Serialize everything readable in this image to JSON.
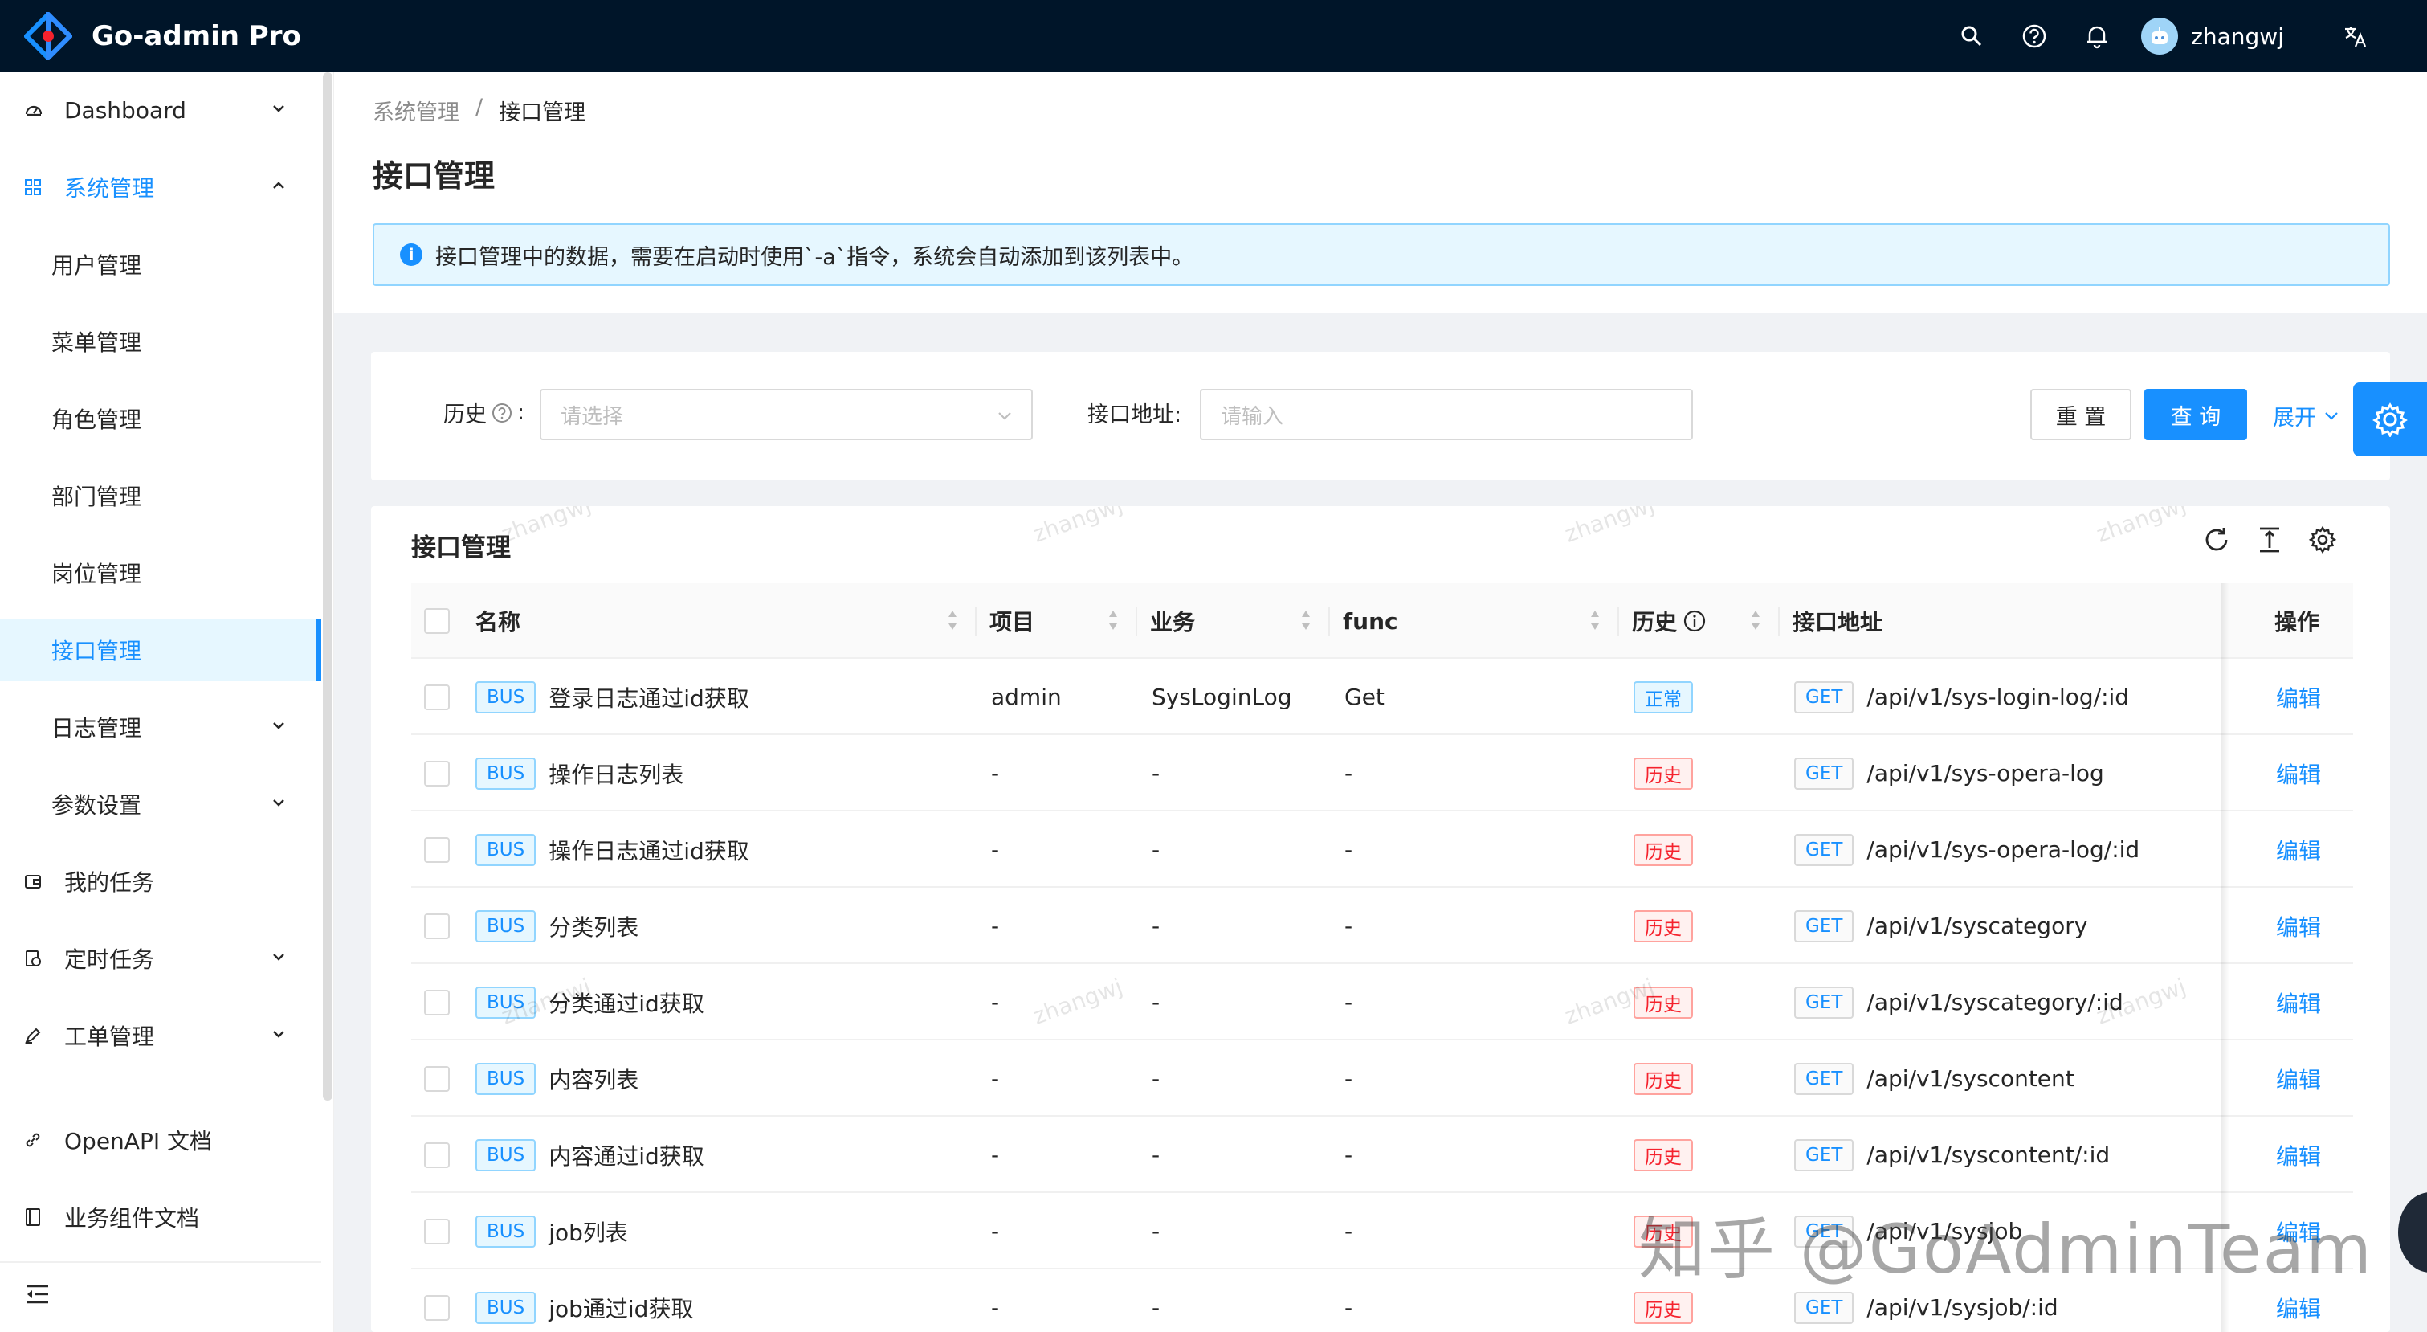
{
  "app": {
    "title": "Go-admin Pro",
    "username": "zhangwj",
    "accent": "#1890ff",
    "header_bg": "#001529"
  },
  "sidebar": {
    "items": [
      {
        "label": "Dashboard",
        "icon": "dashboard-icon",
        "expandable": true
      },
      {
        "label": "系统管理",
        "icon": "appstore-icon",
        "expandable": true,
        "open": true
      },
      {
        "label": "用户管理",
        "sub": true
      },
      {
        "label": "菜单管理",
        "sub": true
      },
      {
        "label": "角色管理",
        "sub": true
      },
      {
        "label": "部门管理",
        "sub": true
      },
      {
        "label": "岗位管理",
        "sub": true
      },
      {
        "label": "接口管理",
        "sub": true,
        "active": true
      },
      {
        "label": "日志管理",
        "sub": true,
        "expandable": true
      },
      {
        "label": "参数设置",
        "sub": true,
        "expandable": true
      },
      {
        "label": "我的任务",
        "icon": "wallet-icon"
      },
      {
        "label": "定时任务",
        "icon": "schedule-icon",
        "expandable": true
      },
      {
        "label": "工单管理",
        "icon": "pen-icon",
        "expandable": true
      },
      {
        "label": "OpenAPI 文档",
        "icon": "link-icon"
      },
      {
        "label": "业务组件文档",
        "icon": "book-icon"
      }
    ]
  },
  "header": {
    "breadcrumb": [
      "系统管理",
      "接口管理"
    ],
    "breadcrumb_sep": "/",
    "title": "接口管理",
    "alert": "接口管理中的数据，需要在启动时使用`-a`指令，系统会自动添加到该列表中。"
  },
  "filter": {
    "history_label": "历史",
    "history_colon": ":",
    "history_placeholder": "请选择",
    "path_label": "接口地址:",
    "path_placeholder": "请输入",
    "reset": "重 置",
    "query": "查 询",
    "expand": "展开"
  },
  "table": {
    "title": "接口管理",
    "columns": [
      "名称",
      "项目",
      "业务",
      "func",
      "历史",
      "接口地址",
      "操作"
    ],
    "rows": [
      {
        "tag": "BUS",
        "name": "登录日志通过id获取",
        "project": "admin",
        "business": "SysLoginLog",
        "func": "Get",
        "status": "正常",
        "method": "GET",
        "path": "/api/v1/sys-login-log/:id",
        "op": "编辑"
      },
      {
        "tag": "BUS",
        "name": "操作日志列表",
        "project": "-",
        "business": "-",
        "func": "-",
        "status": "历史",
        "method": "GET",
        "path": "/api/v1/sys-opera-log",
        "op": "编辑"
      },
      {
        "tag": "BUS",
        "name": "操作日志通过id获取",
        "project": "-",
        "business": "-",
        "func": "-",
        "status": "历史",
        "method": "GET",
        "path": "/api/v1/sys-opera-log/:id",
        "op": "编辑"
      },
      {
        "tag": "BUS",
        "name": "分类列表",
        "project": "-",
        "business": "-",
        "func": "-",
        "status": "历史",
        "method": "GET",
        "path": "/api/v1/syscategory",
        "op": "编辑"
      },
      {
        "tag": "BUS",
        "name": "分类通过id获取",
        "project": "-",
        "business": "-",
        "func": "-",
        "status": "历史",
        "method": "GET",
        "path": "/api/v1/syscategory/:id",
        "op": "编辑"
      },
      {
        "tag": "BUS",
        "name": "内容列表",
        "project": "-",
        "business": "-",
        "func": "-",
        "status": "历史",
        "method": "GET",
        "path": "/api/v1/syscontent",
        "op": "编辑"
      },
      {
        "tag": "BUS",
        "name": "内容通过id获取",
        "project": "-",
        "business": "-",
        "func": "-",
        "status": "历史",
        "method": "GET",
        "path": "/api/v1/syscontent/:id",
        "op": "编辑"
      },
      {
        "tag": "BUS",
        "name": "job列表",
        "project": "-",
        "business": "-",
        "func": "-",
        "status": "历史",
        "method": "GET",
        "path": "/api/v1/sysjob",
        "op": "编辑"
      },
      {
        "tag": "BUS",
        "name": "job通过id获取",
        "project": "-",
        "business": "-",
        "func": "-",
        "status": "历史",
        "method": "GET",
        "path": "/api/v1/sysjob/:id",
        "op": "编辑"
      }
    ]
  },
  "watermark": {
    "text": "zhangwj",
    "zhihu": "知乎 @GoAdminTeam"
  }
}
